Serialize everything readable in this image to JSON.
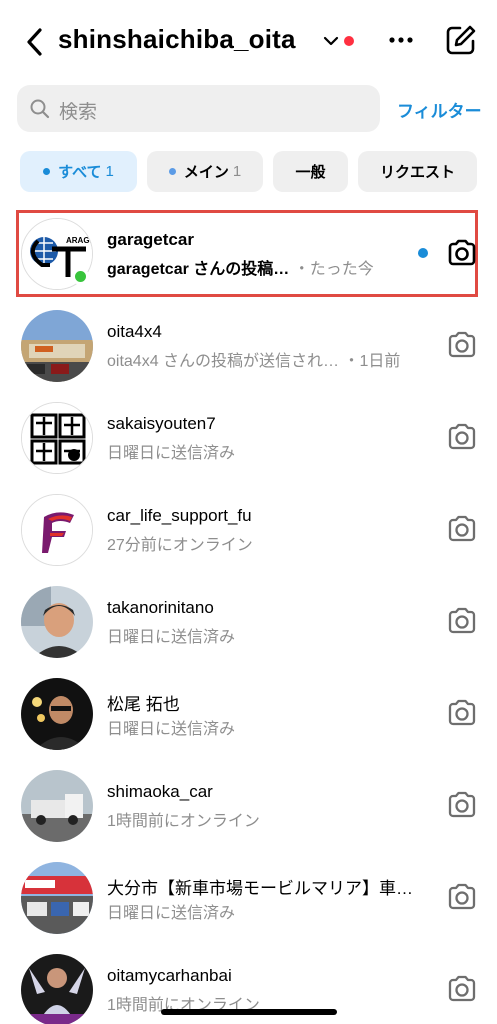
{
  "header": {
    "title": "shinshaichiba_oita",
    "notification_color": "#ff3040"
  },
  "search": {
    "placeholder": "検索",
    "filter_label": "フィルター"
  },
  "chips": [
    {
      "label": "すべて",
      "count": "1",
      "active": true
    },
    {
      "label": "メイン",
      "count": "1",
      "active": false
    },
    {
      "label": "一般",
      "count": "",
      "active": false
    },
    {
      "label": "リクエスト",
      "count": "",
      "active": false
    }
  ],
  "conversations": [
    {
      "name": "garagetcar",
      "preview": "garagetcar さんの投稿…",
      "time": "・たった今",
      "unread": true,
      "online": true,
      "highlighted": true
    },
    {
      "name": "oita4x4",
      "preview": "oita4x4 さんの投稿が送信され…",
      "time": "・1日前",
      "unread": false
    },
    {
      "name": "sakaisyouten7",
      "preview": "日曜日に送信済み",
      "time": "",
      "unread": false
    },
    {
      "name": "car_life_support_fu",
      "preview": "27分前にオンライン",
      "time": "",
      "unread": false
    },
    {
      "name": "takanorinitano",
      "preview": "日曜日に送信済み",
      "time": "",
      "unread": false
    },
    {
      "name": "松尾 拓也",
      "preview": "日曜日に送信済み",
      "time": "",
      "unread": false
    },
    {
      "name": "shimaoka_car",
      "preview": "1時間前にオンライン",
      "time": "",
      "unread": false
    },
    {
      "name": "大分市【新車市場モービルマリア】車…",
      "preview": "日曜日に送信済み",
      "time": "",
      "unread": false
    },
    {
      "name": "oitamycarhanbai",
      "preview": "1時間前にオンライン",
      "time": "",
      "unread": false
    }
  ],
  "colors": {
    "accent": "#1a8cd8",
    "highlight_border": "#e04a42",
    "online": "#38c43c"
  }
}
